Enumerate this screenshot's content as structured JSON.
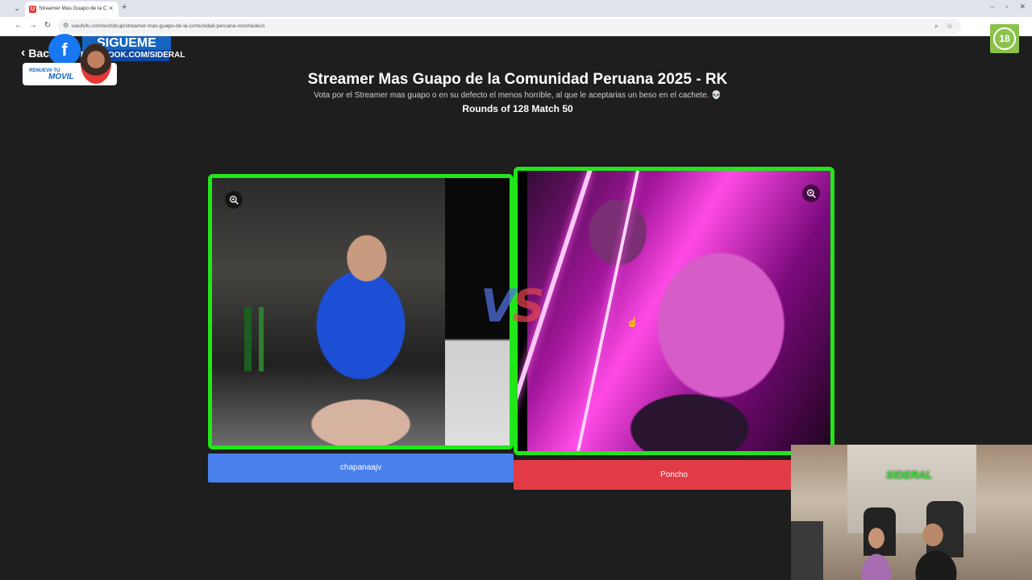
{
  "browser": {
    "tab_title": "Streamer Mas Guapo de la Co...",
    "tab_favicon": "U",
    "url": "uwufufu.com/worldcup/streamer-mas-guapo-de-la-comunidad-peruana-ronchaskun"
  },
  "overlay": {
    "sigueme": "SIGUEME",
    "facebook": "FACEBOOK.COM/SIDERAL",
    "renueva": "RENUEVA TU",
    "movil": "MOVIL"
  },
  "page": {
    "back_label": "Back",
    "age_badge": "18",
    "title": "Streamer Mas Guapo de la Comunidad Peruana 2025 - RK",
    "subtitle": "Vota por el Streamer mas guapo o en su defecto el menos horrible, al que le aceptarias un beso en el cachete. 💀",
    "rounds": "Rounds of 128 Match 50",
    "vs_v": "V",
    "vs_s": "S"
  },
  "candidates": [
    {
      "name": "chapanaajv",
      "button_color": "#4a80ec"
    },
    {
      "name": "Poncho",
      "button_color": "#e23b46"
    }
  ],
  "webcam": {
    "logo": "SIDERAL"
  },
  "colors": {
    "card_border": "#22e61a",
    "background": "#1e1e1e"
  }
}
